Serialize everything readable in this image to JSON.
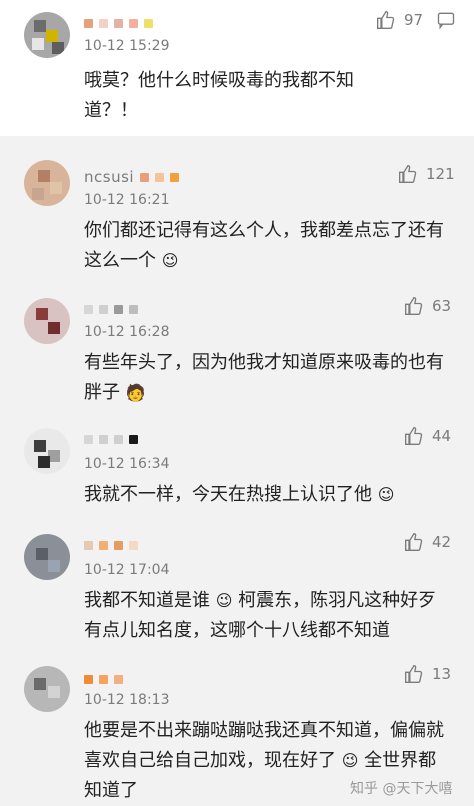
{
  "comments": [
    {
      "time": "10-12 15:29",
      "likes": "97",
      "text_lines": [
        "哦莫？他什么时候吸毒的我都不知",
        "道？！"
      ]
    },
    {
      "time": "10-12 16:21",
      "likes": "121",
      "username_partial": "ncsusi",
      "text_lines": [
        "你们都还记得有这么个人，我都差点忘了还有",
        "这么一个"
      ],
      "emoji": "😉"
    },
    {
      "time": "10-12 16:28",
      "likes": "63",
      "text_lines": [
        "有些年头了，因为他我才知道原来吸毒的也有",
        "胖子"
      ],
      "emoji": "🧑"
    },
    {
      "time": "10-12 16:34",
      "likes": "44",
      "text_lines": [
        "我就不一样，今天在热搜上认识了他"
      ],
      "emoji": "😉"
    },
    {
      "time": "10-12 17:04",
      "likes": "42",
      "text_lines": [
        "我都不知道是谁",
        "柯震东，陈羽凡这种好歹",
        "有点儿知名度，这哪个十八线都不知道"
      ],
      "emoji": "😉"
    },
    {
      "time": "10-12 18:13",
      "likes": "13",
      "text_lines": [
        "他要是不出来蹦哒蹦哒我还真不知道，偏偏就",
        "喜欢自己给自己加戏，现在好了",
        "全世界都",
        "知道了"
      ],
      "emoji": "😉"
    }
  ],
  "watermark": "知乎 @天下大嘻",
  "icons": {
    "like": "thumbs-up-icon",
    "reply": "reply-icon"
  }
}
